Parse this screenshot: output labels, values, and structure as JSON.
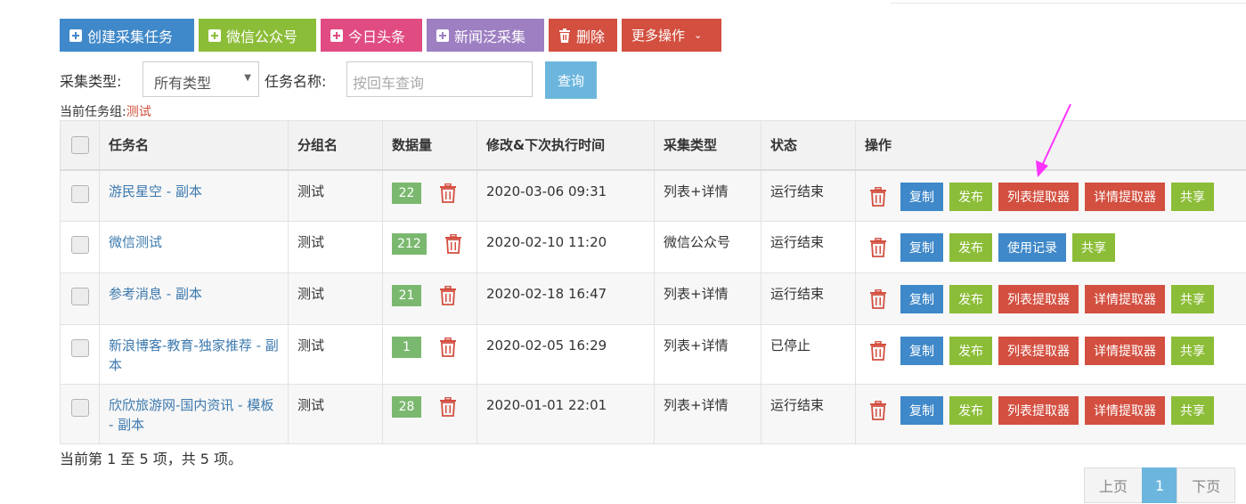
{
  "toolbar": {
    "create_task": "创建采集任务",
    "wechat": "微信公众号",
    "toutiao": "今日头条",
    "news": "新闻泛采集",
    "delete": "删除",
    "more": "更多操作",
    "colors": {
      "blue": "#3f88c9",
      "green": "#8cbd38",
      "pink": "#e04b82",
      "purple": "#9d7fc2",
      "red": "#d34f40"
    }
  },
  "filters": {
    "type_label": "采集类型:",
    "type_value": "所有类型",
    "name_label": "任务名称:",
    "name_placeholder": "按回车查询",
    "query_button": "查询"
  },
  "group": {
    "label": "当前任务组:",
    "name": "测试"
  },
  "table": {
    "headers": [
      "任务名",
      "分组名",
      "数据量",
      "修改&下次执行时间",
      "采集类型",
      "状态",
      "操作"
    ],
    "rows": [
      {
        "name": "游民星空 - 副本",
        "group": "测试",
        "count": "22",
        "time": "2020-03-06 09:31",
        "type": "列表+详情",
        "status": "运行结束",
        "actions": [
          "复制",
          "发布",
          "列表提取器",
          "详情提取器",
          "共享"
        ]
      },
      {
        "name": "微信测试",
        "group": "测试",
        "count": "212",
        "time": "2020-02-10 11:20",
        "type": "微信公众号",
        "status": "运行结束",
        "actions": [
          "复制",
          "发布",
          "使用记录",
          "共享"
        ]
      },
      {
        "name": "参考消息 - 副本",
        "group": "测试",
        "count": "21",
        "time": "2020-02-18 16:47",
        "type": "列表+详情",
        "status": "运行结束",
        "actions": [
          "复制",
          "发布",
          "列表提取器",
          "详情提取器",
          "共享"
        ]
      },
      {
        "name": "新浪博客-教育-独家推荐 - 副本",
        "group": "测试",
        "count": "1",
        "time": "2020-02-05 16:29",
        "type": "列表+详情",
        "status": "已停止",
        "actions": [
          "复制",
          "发布",
          "列表提取器",
          "详情提取器",
          "共享"
        ]
      },
      {
        "name": "欣欣旅游网-国内资讯 - 模板 - 副本",
        "group": "测试",
        "count": "28",
        "time": "2020-01-01 22:01",
        "type": "列表+详情",
        "status": "运行结束",
        "actions": [
          "复制",
          "发布",
          "列表提取器",
          "详情提取器",
          "共享"
        ]
      }
    ]
  },
  "summary": "当前第 1 至 5 项，共 5 项。",
  "pagination": {
    "prev": "上页",
    "current": "1",
    "next": "下页"
  },
  "annotation": {
    "arrow_color": "#ff33ff",
    "icon": "arrow-pointer-icon"
  }
}
